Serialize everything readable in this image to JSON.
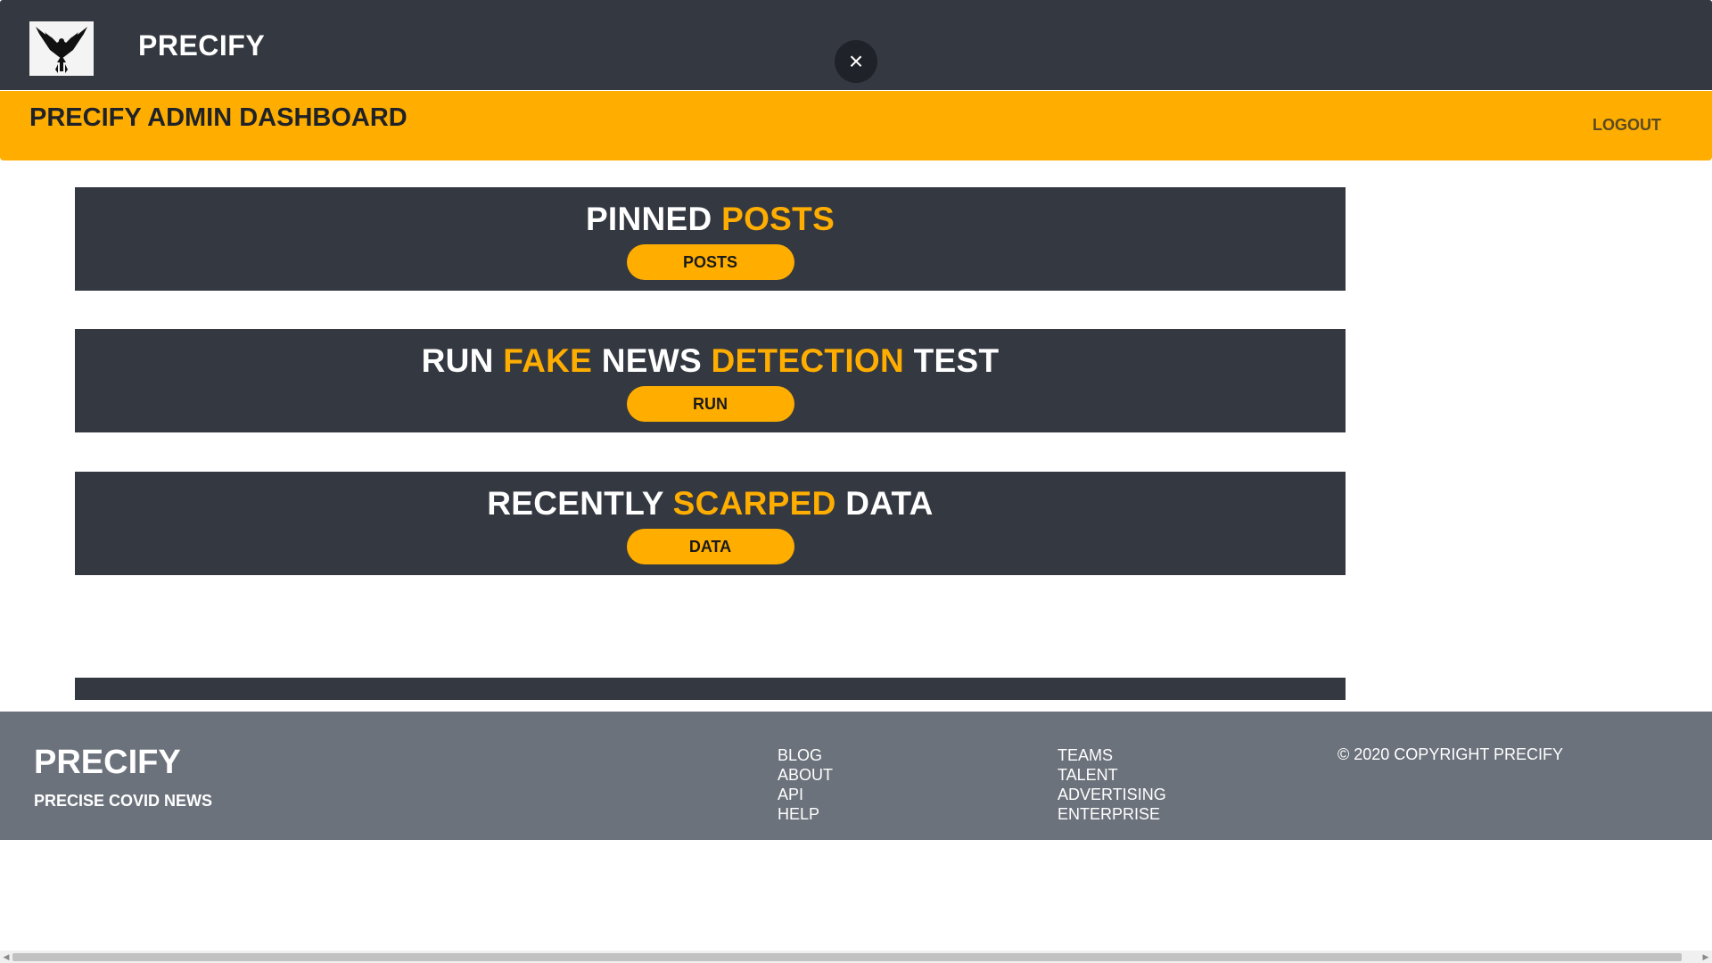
{
  "header": {
    "brand": "PRECIFY",
    "close_symbol": "×"
  },
  "dashboard": {
    "title": "PRECIFY ADMIN DASHBOARD",
    "logout_label": "LOGOUT"
  },
  "panels": [
    {
      "title_parts": [
        "PINNED ",
        "POSTS"
      ],
      "button_label": "POSTS"
    },
    {
      "title_parts": [
        "RUN ",
        "FAKE",
        " NEWS ",
        "DETECTION",
        " TEST"
      ],
      "button_label": "RUN"
    },
    {
      "title_parts": [
        "RECENTLY ",
        "SCARPED",
        " DATA"
      ],
      "button_label": "DATA"
    }
  ],
  "footer": {
    "brand": "PRECIFY",
    "tagline": "PRECISE COVID NEWS",
    "links_col1": [
      "BLOG",
      "ABOUT",
      "API",
      "HELP"
    ],
    "links_col2": [
      "TEAMS",
      "TALENT",
      "ADVERTISING",
      "ENTERPRISE"
    ],
    "copyright": "© 2020 COPYRIGHT PRECIFY"
  },
  "colors": {
    "dark": "#343841",
    "accent": "#ffae00",
    "footer": "#6c727c"
  }
}
